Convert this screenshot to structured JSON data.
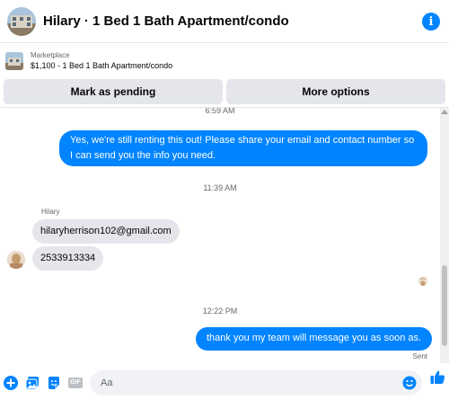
{
  "header": {
    "title": "Hilary · 1 Bed 1 Bath Apartment/condo",
    "info_glyph": "i",
    "thumbnail_icon": "apartment-thumbnail",
    "info_icon": "info-icon"
  },
  "listing": {
    "source": "Marketplace",
    "item": "$1,100 - 1 Bed 1 Bath Apartment/condo",
    "actions": {
      "pending_label": "Mark as pending",
      "more_label": "More options"
    }
  },
  "conversation": {
    "timestamps": {
      "top_partial": "6:59 AM",
      "first": "11:39 AM",
      "second": "12:22 PM"
    },
    "outgoing_1": "Yes, we're still renting this out! Please share your email and contact number so I can send you the info you need.",
    "sender_name": "Hilary",
    "incoming_email": "hilaryherrison102@gmail.com",
    "incoming_phone": "2533913334",
    "outgoing_2": "thank you my team will message you as soon as.",
    "status": "Sent"
  },
  "composer": {
    "placeholder": "Aa",
    "icons": [
      "plus-circle-icon",
      "photo-icon",
      "sticker-icon",
      "gif-icon",
      "emoji-icon",
      "thumbs-up-icon"
    ],
    "gif_label": "GIF"
  },
  "colors": {
    "accent": "#0084ff",
    "bubble_in": "#e4e6eb",
    "muted_text": "#65676b"
  }
}
